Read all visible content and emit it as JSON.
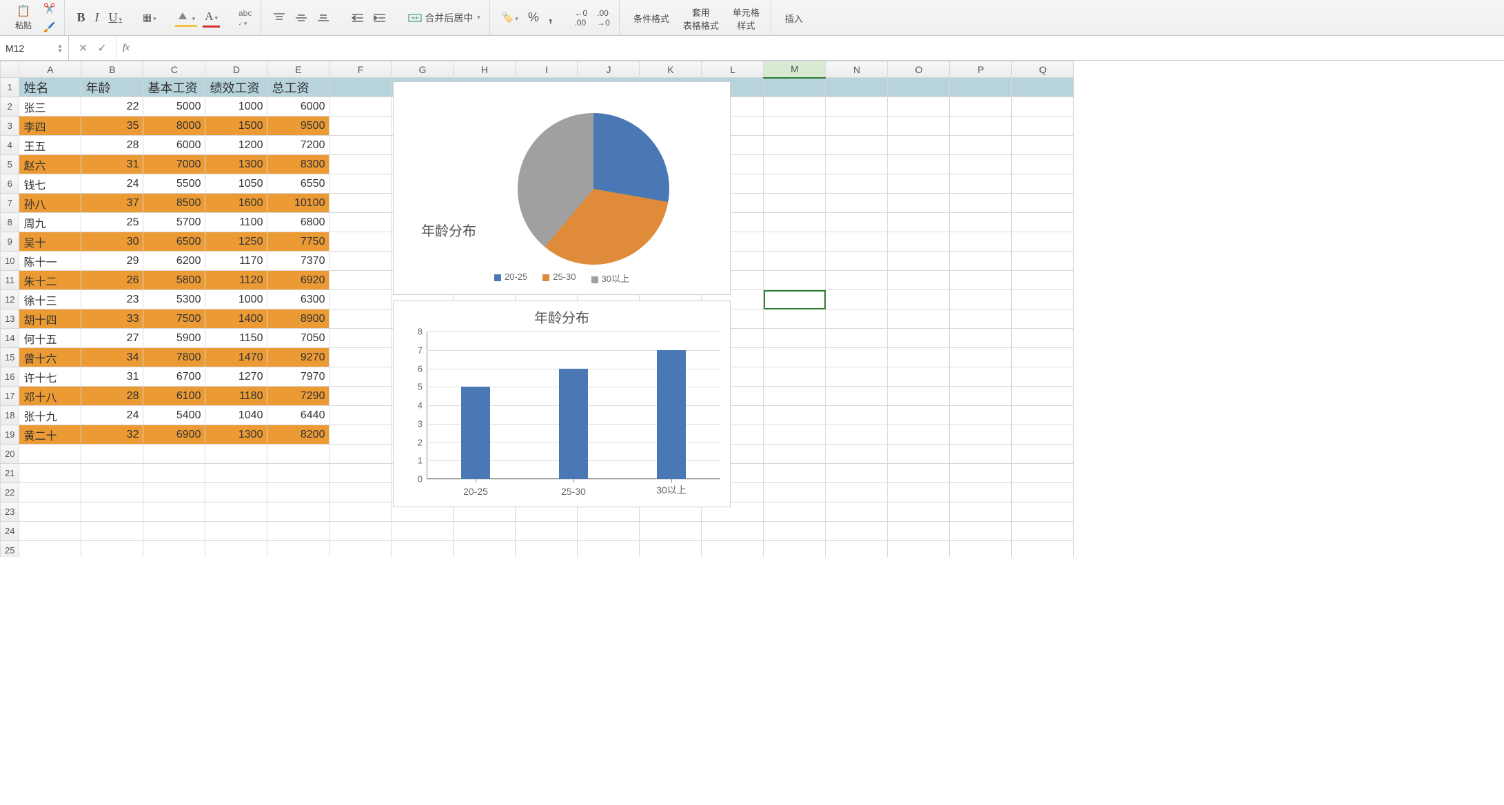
{
  "ribbon": {
    "paste": "粘贴",
    "merge_center": "合并后居中",
    "cond_fmt": "条件格式",
    "table_fmt": "套用\n表格格式",
    "cell_fmt": "单元格\n样式",
    "insert": "插入"
  },
  "formula_bar": {
    "name_box": "M12",
    "fx_label": "fx",
    "value": ""
  },
  "grid": {
    "col_letters": [
      "A",
      "B",
      "C",
      "D",
      "E",
      "F",
      "G",
      "H",
      "I",
      "J",
      "K",
      "L",
      "M",
      "N",
      "O",
      "P",
      "Q"
    ],
    "selected_col": "M",
    "row_numbers": [
      "1",
      "2",
      "3",
      "4",
      "5",
      "6",
      "7",
      "8",
      "9",
      "10",
      "11",
      "12",
      "13",
      "14",
      "15",
      "16",
      "17",
      "18",
      "19",
      "20",
      "21",
      "22",
      "23",
      "24",
      "25"
    ],
    "selected_cell_row": 12
  },
  "table": {
    "headers": [
      "姓名",
      "年龄",
      "基本工资",
      "绩效工资",
      "总工资"
    ],
    "rows": [
      {
        "name": "张三",
        "age": 22,
        "base": 5000,
        "perf": 1000,
        "total": 6000
      },
      {
        "name": "李四",
        "age": 35,
        "base": 8000,
        "perf": 1500,
        "total": 9500
      },
      {
        "name": "王五",
        "age": 28,
        "base": 6000,
        "perf": 1200,
        "total": 7200
      },
      {
        "name": "赵六",
        "age": 31,
        "base": 7000,
        "perf": 1300,
        "total": 8300
      },
      {
        "name": "钱七",
        "age": 24,
        "base": 5500,
        "perf": 1050,
        "total": 6550
      },
      {
        "name": "孙八",
        "age": 37,
        "base": 8500,
        "perf": 1600,
        "total": 10100
      },
      {
        "name": "周九",
        "age": 25,
        "base": 5700,
        "perf": 1100,
        "total": 6800
      },
      {
        "name": "吴十",
        "age": 30,
        "base": 6500,
        "perf": 1250,
        "total": 7750
      },
      {
        "name": "陈十一",
        "age": 29,
        "base": 6200,
        "perf": 1170,
        "total": 7370
      },
      {
        "name": "朱十二",
        "age": 26,
        "base": 5800,
        "perf": 1120,
        "total": 6920
      },
      {
        "name": "徐十三",
        "age": 23,
        "base": 5300,
        "perf": 1000,
        "total": 6300
      },
      {
        "name": "胡十四",
        "age": 33,
        "base": 7500,
        "perf": 1400,
        "total": 8900
      },
      {
        "name": "何十五",
        "age": 27,
        "base": 5900,
        "perf": 1150,
        "total": 7050
      },
      {
        "name": "曾十六",
        "age": 34,
        "base": 7800,
        "perf": 1470,
        "total": 9270
      },
      {
        "name": "许十七",
        "age": 31,
        "base": 6700,
        "perf": 1270,
        "total": 7970
      },
      {
        "name": "邓十八",
        "age": 28,
        "base": 6100,
        "perf": 1180,
        "total": 7290
      },
      {
        "name": "张十九",
        "age": 24,
        "base": 5400,
        "perf": 1040,
        "total": 6440
      },
      {
        "name": "黄二十",
        "age": 32,
        "base": 6900,
        "perf": 1300,
        "total": 8200
      }
    ]
  },
  "chart_data": [
    {
      "type": "pie",
      "title": "年龄分布",
      "categories": [
        "20-25",
        "25-30",
        "30以上"
      ],
      "values": [
        5,
        6,
        7
      ],
      "colors": [
        "#4a78b5",
        "#e08b3a",
        "#a0a0a0"
      ],
      "legend_position": "bottom"
    },
    {
      "type": "bar",
      "title": "年龄分布",
      "categories": [
        "20-25",
        "25-30",
        "30以上"
      ],
      "values": [
        5,
        6,
        7
      ],
      "xlabel": "",
      "ylabel": "",
      "ylim": [
        0,
        8
      ],
      "yticks": [
        0,
        1,
        2,
        3,
        4,
        5,
        6,
        7,
        8
      ],
      "bar_color": "#4a78b5"
    }
  ]
}
